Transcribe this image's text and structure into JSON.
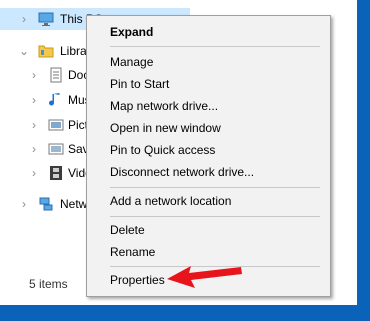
{
  "nav_tree": {
    "this_pc": {
      "label": "This PC",
      "icon": "computer-icon"
    },
    "libraries": {
      "label": "Libraries",
      "icon": "libraries-folder-icon"
    },
    "library_items": [
      {
        "label": "Documents",
        "icon": "documents-library-icon"
      },
      {
        "label": "Music",
        "icon": "music-library-icon"
      },
      {
        "label": "Pictures",
        "icon": "pictures-library-icon"
      },
      {
        "label": "Saved Pictures",
        "icon": "saved-pictures-icon"
      },
      {
        "label": "Videos",
        "icon": "videos-library-icon"
      }
    ],
    "network": {
      "label": "Network",
      "icon": "network-icon"
    }
  },
  "status_bar": {
    "item_count": "5 items"
  },
  "context_menu": {
    "expand": "Expand",
    "manage": "Manage",
    "pin_to_start": "Pin to Start",
    "map_network_drive": "Map network drive...",
    "open_in_new_window": "Open in new window",
    "pin_to_quick_access": "Pin to Quick access",
    "disconnect_network_drive": "Disconnect network drive...",
    "add_network_location": "Add a network location",
    "delete": "Delete",
    "rename": "Rename",
    "properties": "Properties"
  },
  "colors": {
    "desktop_blue": "#0a63b8",
    "selection": "#cce8ff",
    "annotation_arrow": "#e8141c"
  }
}
